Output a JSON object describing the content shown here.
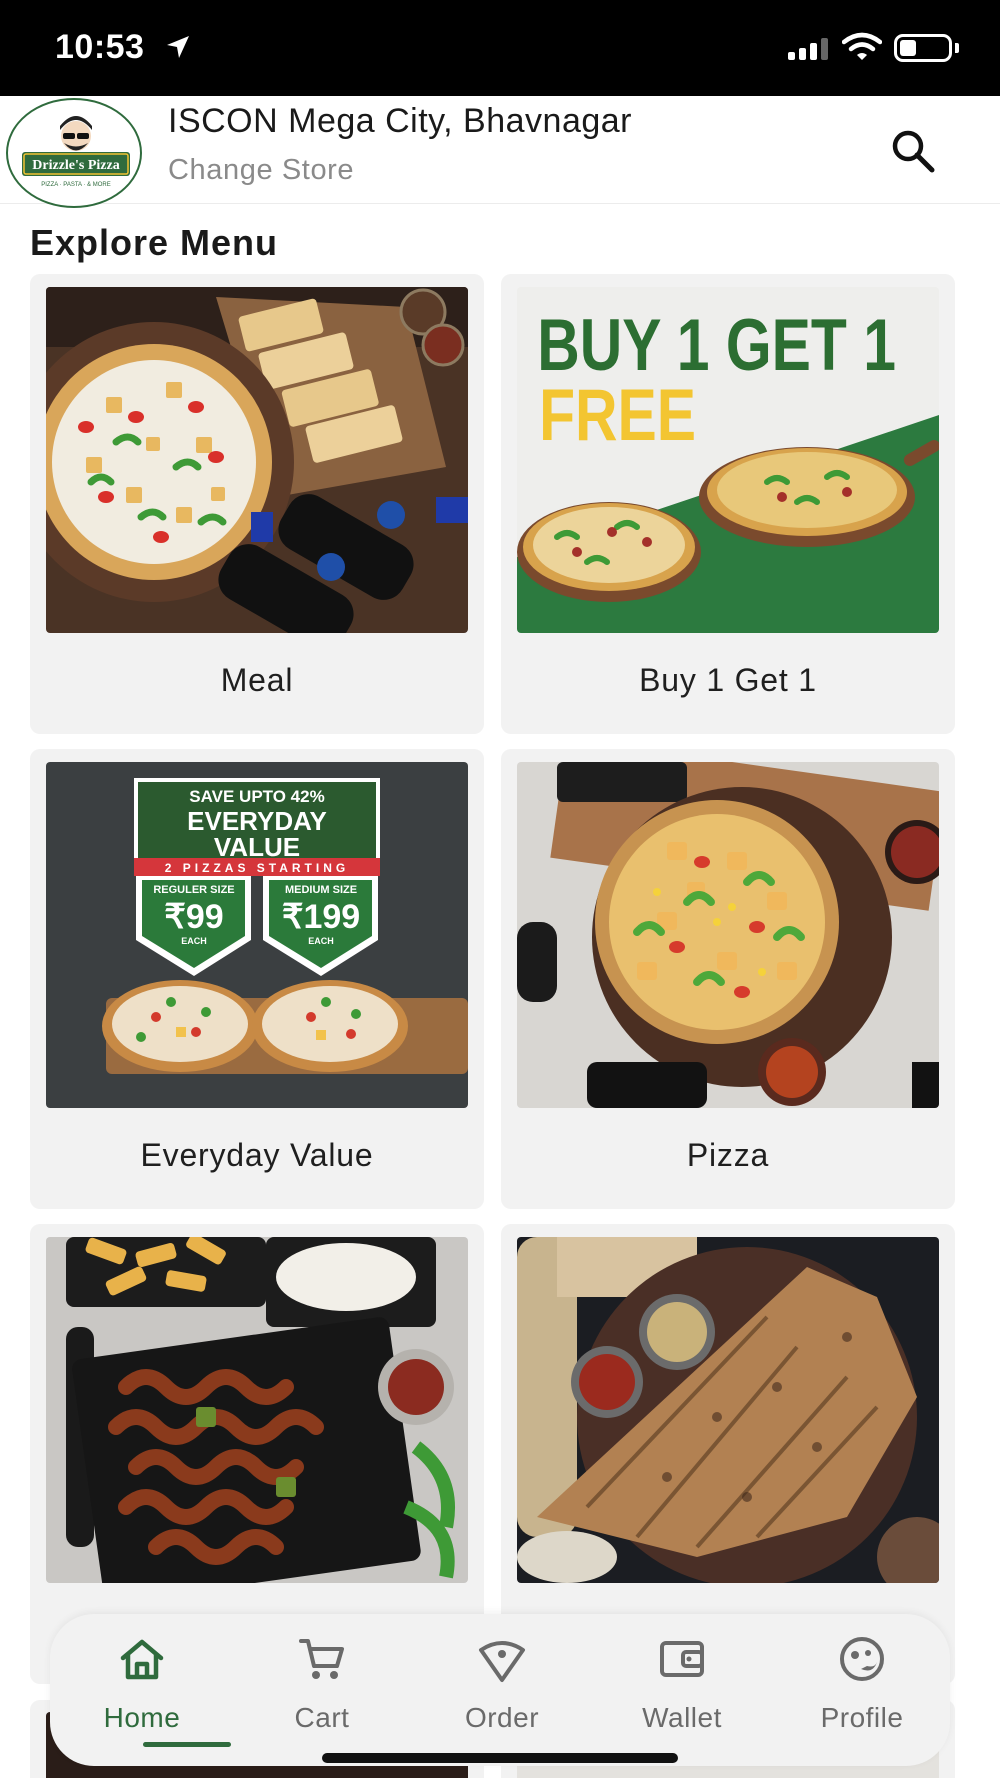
{
  "status_bar": {
    "time": "10:53"
  },
  "header": {
    "logo_text": "Drizzle's Pizza",
    "store_name": "ISCON Mega City, Bhavnagar",
    "change_store_label": "Change Store"
  },
  "menu": {
    "title": "Explore Menu",
    "items": [
      {
        "label": "Meal",
        "image": "meal-combo-image"
      },
      {
        "label": "Buy 1 Get 1",
        "image": "buy-one-get-one-image",
        "banner_line1": "BUY 1 GET 1",
        "banner_line2": "FREE"
      },
      {
        "label": "Everyday Value",
        "image": "everyday-value-image",
        "promo_top": "SAVE UPTO 42%",
        "promo_title_1": "EVERYDAY",
        "promo_title_2": "VALUE",
        "promo_strip": "2 PIZZAS STARTING",
        "price_1_size": "REGULER SIZE",
        "price_1": "₹99",
        "price_2_size": "MEDIUM SIZE",
        "price_2": "₹199",
        "each": "EACH"
      },
      {
        "label": "Pizza",
        "image": "pizza-image"
      },
      {
        "label": "",
        "image": "pasta-image"
      },
      {
        "label": "",
        "image": "calzone-image"
      }
    ]
  },
  "bottom_nav": {
    "items": [
      {
        "label": "Home",
        "icon": "home-icon",
        "active": true
      },
      {
        "label": "Cart",
        "icon": "cart-icon",
        "active": false
      },
      {
        "label": "Order",
        "icon": "order-icon",
        "active": false
      },
      {
        "label": "Wallet",
        "icon": "wallet-icon",
        "active": false
      },
      {
        "label": "Profile",
        "icon": "profile-icon",
        "active": false
      }
    ]
  },
  "colors": {
    "brand_green": "#2f6b3d",
    "card_bg": "#f2f2f2",
    "nav_inactive": "#6a6a6a"
  }
}
